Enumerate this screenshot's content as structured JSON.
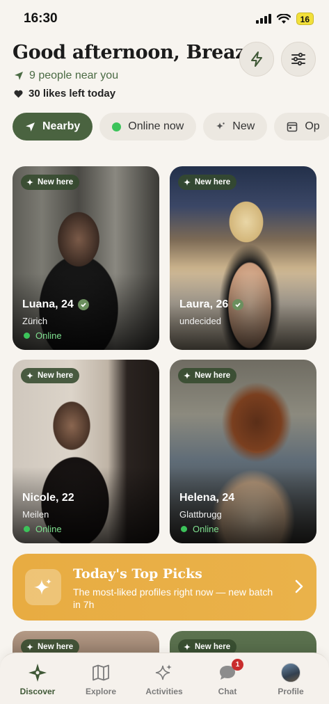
{
  "status": {
    "time": "16:30",
    "battery": "16"
  },
  "header": {
    "greeting": "Good afternoon, Breazy",
    "near": "9 people near you",
    "likes": "30 likes left today"
  },
  "chips": [
    {
      "label": "Nearby",
      "icon": "navigation-arrow-icon",
      "active": true
    },
    {
      "label": "Online now",
      "icon": "green-dot-icon"
    },
    {
      "label": "New",
      "icon": "sparkle-icon"
    },
    {
      "label": "Op",
      "icon": "calendar-icon"
    }
  ],
  "cards": [
    {
      "badge": "New here",
      "name": "Luana, 24",
      "verified": true,
      "location": "Zürich",
      "status": "Online"
    },
    {
      "badge": "New here",
      "name": "Laura, 26",
      "verified": true,
      "location": "undecided",
      "status": ""
    },
    {
      "badge": "New here",
      "name": "Nicole, 22",
      "verified": false,
      "location": "Meilen",
      "status": "Online"
    },
    {
      "badge": "New here",
      "name": "Helena, 24",
      "verified": false,
      "location": "Glattbrugg",
      "status": "Online"
    }
  ],
  "peek": [
    {
      "badge": "New here"
    },
    {
      "badge": "New here"
    }
  ],
  "top_picks": {
    "title": "Today's Top Picks",
    "subtitle": "The most-liked profiles right now — new batch in 7h"
  },
  "tabs": [
    {
      "label": "Discover",
      "icon": "compass-star-icon",
      "active": true
    },
    {
      "label": "Explore",
      "icon": "map-icon"
    },
    {
      "label": "Activities",
      "icon": "sparkles-icon"
    },
    {
      "label": "Chat",
      "icon": "chat-bubble-icon",
      "badge": "1"
    },
    {
      "label": "Profile",
      "icon": "avatar"
    }
  ],
  "colors": {
    "accent": "#4a6340",
    "online": "#3cc35a",
    "picks": "#e8ac42"
  }
}
